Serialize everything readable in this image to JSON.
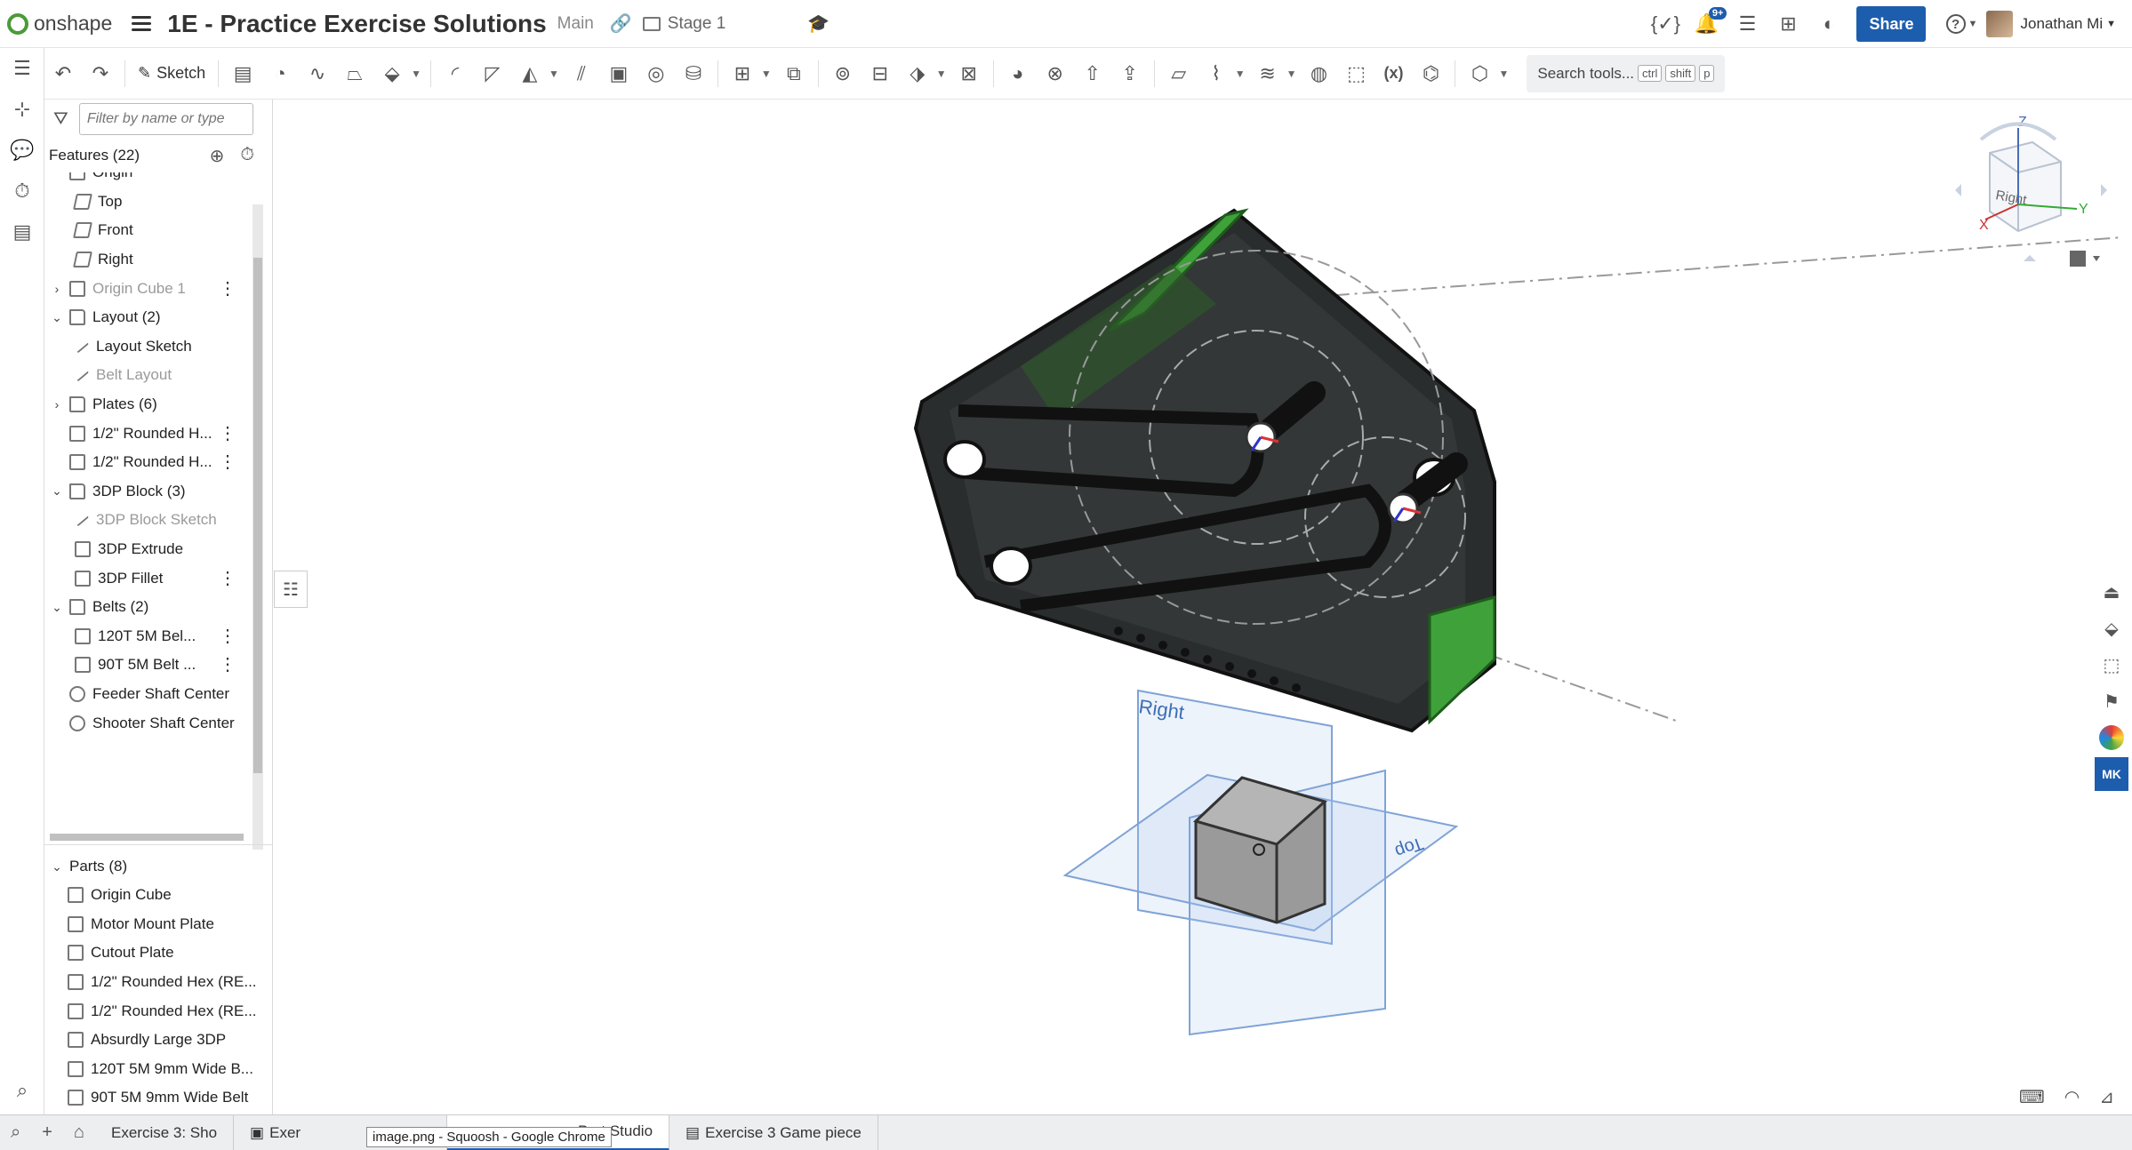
{
  "app": {
    "brand": "onshape",
    "accent": "#1d5dad",
    "green": "#4c9a3a"
  },
  "header": {
    "doc_title": "1E - Practice Exercise Solutions",
    "branch": "Main",
    "stage": "Stage 1",
    "notifications_badge": "9+",
    "share_label": "Share",
    "help_label": "?",
    "user_name": "Jonathan Mi"
  },
  "toolbar": {
    "sketch_label": "Sketch",
    "search_label": "Search tools...",
    "shortcut_keys": [
      "ctrl",
      "shift",
      "p"
    ]
  },
  "panel": {
    "filter_placeholder": "Filter by name or type",
    "features_header": "Features (22)",
    "tree": [
      {
        "label": "Origin",
        "icon": "origin-icon",
        "dim": false,
        "chevron": ""
      },
      {
        "label": "Top",
        "icon": "plane-icon",
        "dim": false,
        "chevron": ""
      },
      {
        "label": "Front",
        "icon": "plane-icon",
        "dim": false,
        "chevron": ""
      },
      {
        "label": "Right",
        "icon": "plane-icon",
        "dim": false,
        "chevron": ""
      },
      {
        "label": "Origin Cube 1",
        "icon": "part-icon",
        "dim": true,
        "chevron": "›",
        "dots": true
      },
      {
        "label": "Layout (2)",
        "icon": "folder-icon",
        "dim": false,
        "chevron": "⌄"
      },
      {
        "label": "Layout Sketch",
        "icon": "sketch-icon",
        "dim": false,
        "chevron": ""
      },
      {
        "label": "Belt Layout",
        "icon": "sketch-icon",
        "dim": true,
        "chevron": ""
      },
      {
        "label": "Plates (6)",
        "icon": "folder-icon",
        "dim": false,
        "chevron": "›"
      },
      {
        "label": "1/2\" Rounded H...",
        "icon": "custom-feature-icon",
        "dim": false,
        "chevron": "",
        "dots": true
      },
      {
        "label": "1/2\" Rounded H...",
        "icon": "custom-feature-icon",
        "dim": false,
        "chevron": "",
        "dots": true
      },
      {
        "label": "3DP Block (3)",
        "icon": "folder-icon",
        "dim": false,
        "chevron": "⌄"
      },
      {
        "label": "3DP Block Sketch",
        "icon": "sketch-icon",
        "dim": true,
        "chevron": ""
      },
      {
        "label": "3DP Extrude",
        "icon": "extrude-icon",
        "dim": false,
        "chevron": ""
      },
      {
        "label": "3DP Fillet",
        "icon": "fillet-icon",
        "dim": false,
        "chevron": "",
        "dots": true
      },
      {
        "label": "Belts (2)",
        "icon": "folder-icon",
        "dim": false,
        "chevron": "⌄"
      },
      {
        "label": "120T 5M Bel...",
        "icon": "belt-icon",
        "dim": false,
        "chevron": "",
        "dots": true
      },
      {
        "label": "90T 5M Belt ...",
        "icon": "belt-icon",
        "dim": false,
        "chevron": "",
        "dots": true
      },
      {
        "label": "Feeder Shaft Center",
        "icon": "mate-connector-icon",
        "dim": false,
        "chevron": ""
      },
      {
        "label": "Shooter Shaft Center",
        "icon": "mate-connector-icon",
        "dim": false,
        "chevron": ""
      }
    ],
    "parts_header": "Parts (8)",
    "parts": [
      "Origin Cube",
      "Motor Mount Plate",
      "Cutout Plate",
      "1/2\" Rounded Hex (RE...",
      "1/2\" Rounded Hex (RE...",
      "Absurdly Large 3DP",
      "120T 5M 9mm Wide B...",
      "90T 5M 9mm Wide Belt"
    ]
  },
  "viewport": {
    "plane_right": "Right",
    "plane_top": "Top",
    "viewcube": {
      "z": "Z",
      "x": "X",
      "y": "Y",
      "face": "Right"
    }
  },
  "tabs": [
    {
      "label": "Exercise 3: Sho",
      "active": false
    },
    {
      "label": "Exer",
      "active": false
    },
    {
      "label": "Part Studio",
      "active": true
    },
    {
      "label": "Exercise 3 Game piece",
      "active": false
    }
  ],
  "tooltip": "image.png - Squoosh - Google Chrome"
}
